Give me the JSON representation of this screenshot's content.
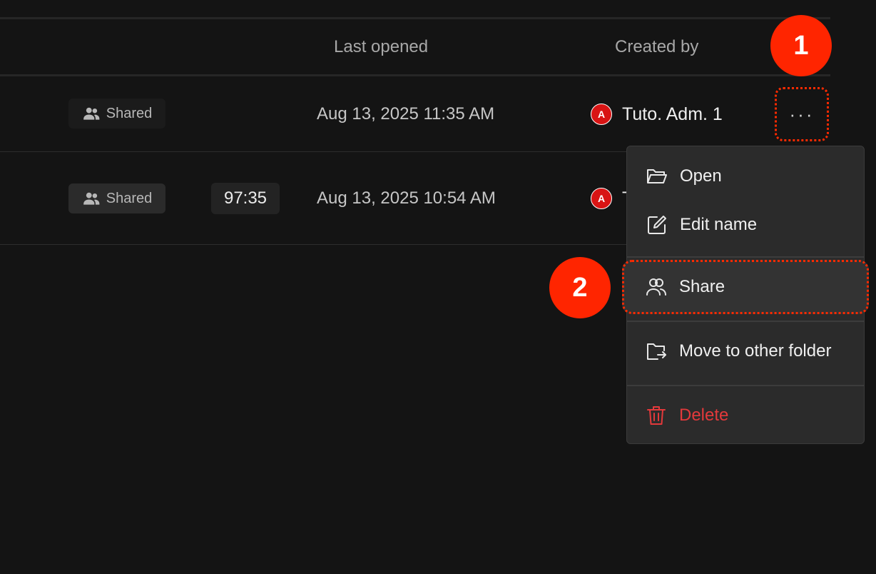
{
  "table": {
    "columns": {
      "last_opened": "Last opened",
      "created_by": "Created by"
    },
    "rows": [
      {
        "shared_label": "Shared",
        "last_opened": "Aug 13, 2025 11:35 AM",
        "creator_initial": "A",
        "creator_name": "Tuto. Adm. 1"
      },
      {
        "shared_label": "Shared",
        "duration": "97:35",
        "last_opened": "Aug 13, 2025 10:54 AM",
        "creator_initial": "A",
        "creator_name": "T"
      }
    ]
  },
  "row_actions": {
    "more_label": "···"
  },
  "context_menu": {
    "items": [
      {
        "label": "Open",
        "icon": "folder-open-icon"
      },
      {
        "label": "Edit name",
        "icon": "edit-icon"
      },
      {
        "label": "Share",
        "icon": "users-icon"
      },
      {
        "label": "Move to other folder",
        "icon": "folder-move-icon"
      },
      {
        "label": "Delete",
        "icon": "trash-icon"
      }
    ]
  },
  "annotations": {
    "step1": "1",
    "step2": "2"
  },
  "colors": {
    "background": "#141414",
    "menu_background": "#2b2b2b",
    "annotation_red": "#ff2500",
    "delete_red": "#e3393b",
    "avatar_red": "#d81414"
  }
}
